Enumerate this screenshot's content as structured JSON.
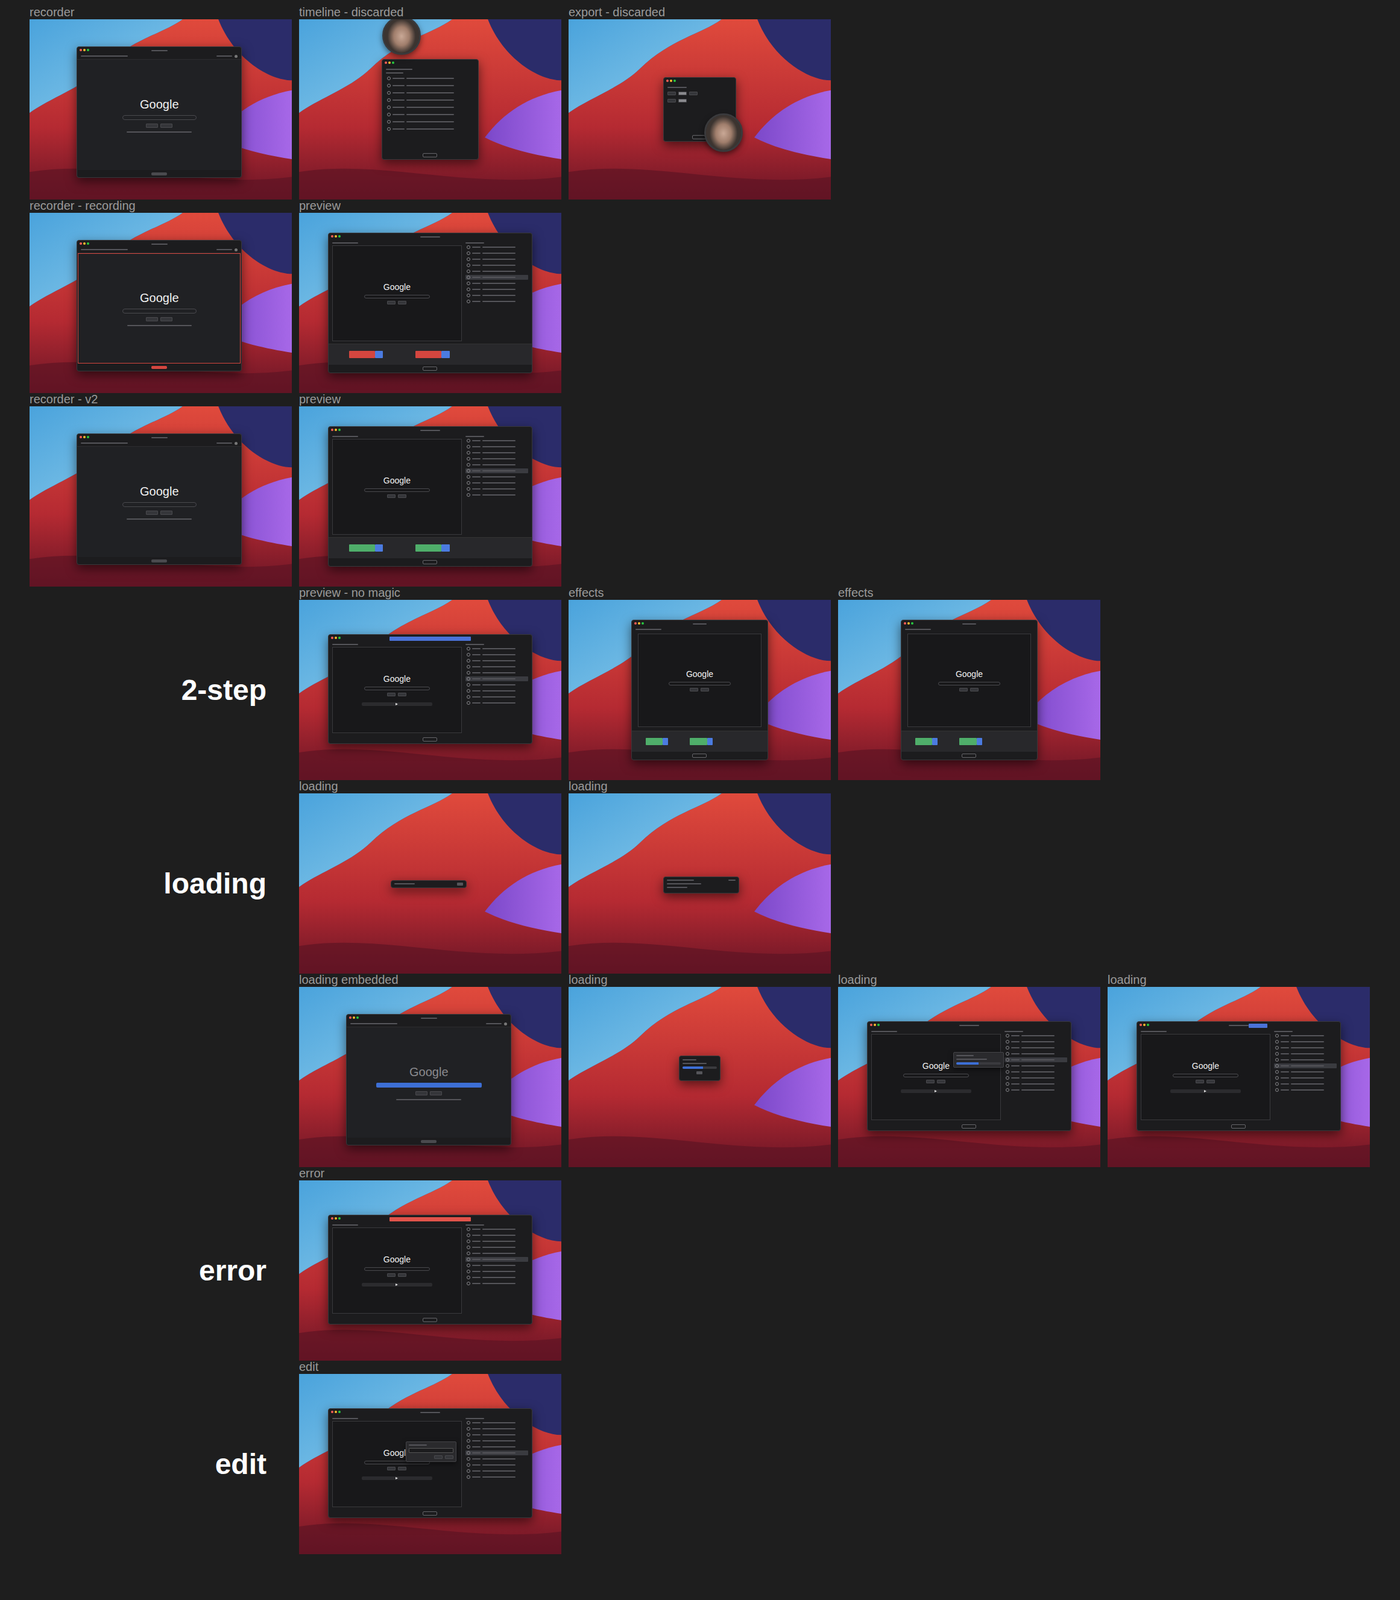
{
  "sections": [
    {
      "label": "2-step"
    },
    {
      "label": "loading"
    },
    {
      "label": "error"
    },
    {
      "label": "edit"
    }
  ],
  "frames": [
    {
      "label": "recorder",
      "kind": "browser",
      "google": "Google",
      "recording": false
    },
    {
      "label": "timeline - discarded",
      "kind": "timeline",
      "avatar": true
    },
    {
      "label": "export - discarded",
      "kind": "export",
      "avatar": true
    },
    {
      "label": "recorder - recording",
      "kind": "browser",
      "google": "Google",
      "recording": true
    },
    {
      "label": "preview",
      "kind": "preview",
      "google": "Google",
      "actions": [
        {
          "selected": false
        },
        {
          "selected": false
        },
        {
          "selected": false
        },
        {
          "selected": false
        },
        {
          "selected": false
        },
        {
          "selected": true
        },
        {
          "selected": false
        },
        {
          "selected": false
        },
        {
          "selected": false
        },
        {
          "selected": false
        }
      ],
      "clips": [
        {
          "color": "#d4463f"
        },
        {
          "color": "#4b7be0"
        },
        {
          "color": "#d4463f"
        },
        {
          "color": "#4b7be0"
        }
      ]
    },
    {
      "label": "recorder - v2",
      "kind": "browser",
      "google": "Google",
      "recording": false
    },
    {
      "label": "preview",
      "kind": "preview",
      "google": "Google",
      "actions": [
        {
          "selected": false
        },
        {
          "selected": false
        },
        {
          "selected": false
        },
        {
          "selected": false
        },
        {
          "selected": false
        },
        {
          "selected": true
        },
        {
          "selected": false
        },
        {
          "selected": false
        },
        {
          "selected": false
        },
        {
          "selected": false
        }
      ],
      "clips": [
        {
          "color": "#4fae6a"
        },
        {
          "color": "#4b7be0"
        },
        {
          "color": "#4fae6a"
        },
        {
          "color": "#4b7be0"
        }
      ]
    },
    {
      "label": "preview - no magic",
      "kind": "script",
      "google": "Google",
      "banner_color": "#4a72d8",
      "actions": [
        {
          "selected": false
        },
        {
          "selected": false
        },
        {
          "selected": false
        },
        {
          "selected": false
        },
        {
          "selected": false
        },
        {
          "selected": true
        },
        {
          "selected": false
        },
        {
          "selected": false
        },
        {
          "selected": false
        },
        {
          "selected": false
        }
      ]
    },
    {
      "label": "effects",
      "kind": "effects",
      "google": "Google",
      "clips": [
        {
          "color": "#4fae6a"
        },
        {
          "color": "#4b7be0"
        },
        {
          "color": "#4fae6a"
        },
        {
          "color": "#4b7be0"
        }
      ]
    },
    {
      "label": "effects",
      "kind": "effects",
      "google": "Google",
      "clips": [
        {
          "color": "#4fae6a"
        },
        {
          "color": "#4b7be0"
        },
        {
          "color": "#4fae6a"
        },
        {
          "color": "#4b7be0"
        }
      ]
    },
    {
      "label": "loading",
      "kind": "toast"
    },
    {
      "label": "loading",
      "kind": "dialog"
    },
    {
      "label": "loading embedded",
      "kind": "embedded",
      "google": "Google",
      "level": 1
    },
    {
      "label": "loading",
      "kind": "progress",
      "level": 0.6
    },
    {
      "label": "loading",
      "kind": "popover",
      "google": "Google",
      "level": 0.5,
      "actions": [
        {
          "selected": false
        },
        {
          "selected": false
        },
        {
          "selected": false
        },
        {
          "selected": false
        },
        {
          "selected": true
        },
        {
          "selected": false
        },
        {
          "selected": false
        },
        {
          "selected": false
        },
        {
          "selected": false
        },
        {
          "selected": false
        }
      ]
    },
    {
      "label": "loading",
      "kind": "busy",
      "google": "Google",
      "banner_color": "#4a72d8",
      "actions": [
        {
          "selected": false
        },
        {
          "selected": false
        },
        {
          "selected": false
        },
        {
          "selected": false
        },
        {
          "selected": false
        },
        {
          "selected": true
        },
        {
          "selected": false
        },
        {
          "selected": false
        },
        {
          "selected": false
        },
        {
          "selected": false
        }
      ]
    },
    {
      "label": "error",
      "kind": "script",
      "google": "Google",
      "banner_color": "#e0534a",
      "actions": [
        {
          "selected": false
        },
        {
          "selected": false
        },
        {
          "selected": false
        },
        {
          "selected": false
        },
        {
          "selected": false
        },
        {
          "selected": true
        },
        {
          "selected": false
        },
        {
          "selected": false
        },
        {
          "selected": false
        },
        {
          "selected": false
        }
      ]
    },
    {
      "label": "edit",
      "kind": "editor",
      "google": "Google",
      "actions": [
        {
          "selected": false
        },
        {
          "selected": false
        },
        {
          "selected": false
        },
        {
          "selected": false
        },
        {
          "selected": false
        },
        {
          "selected": true
        },
        {
          "selected": false
        },
        {
          "selected": false
        },
        {
          "selected": false
        },
        {
          "selected": false
        }
      ]
    }
  ]
}
